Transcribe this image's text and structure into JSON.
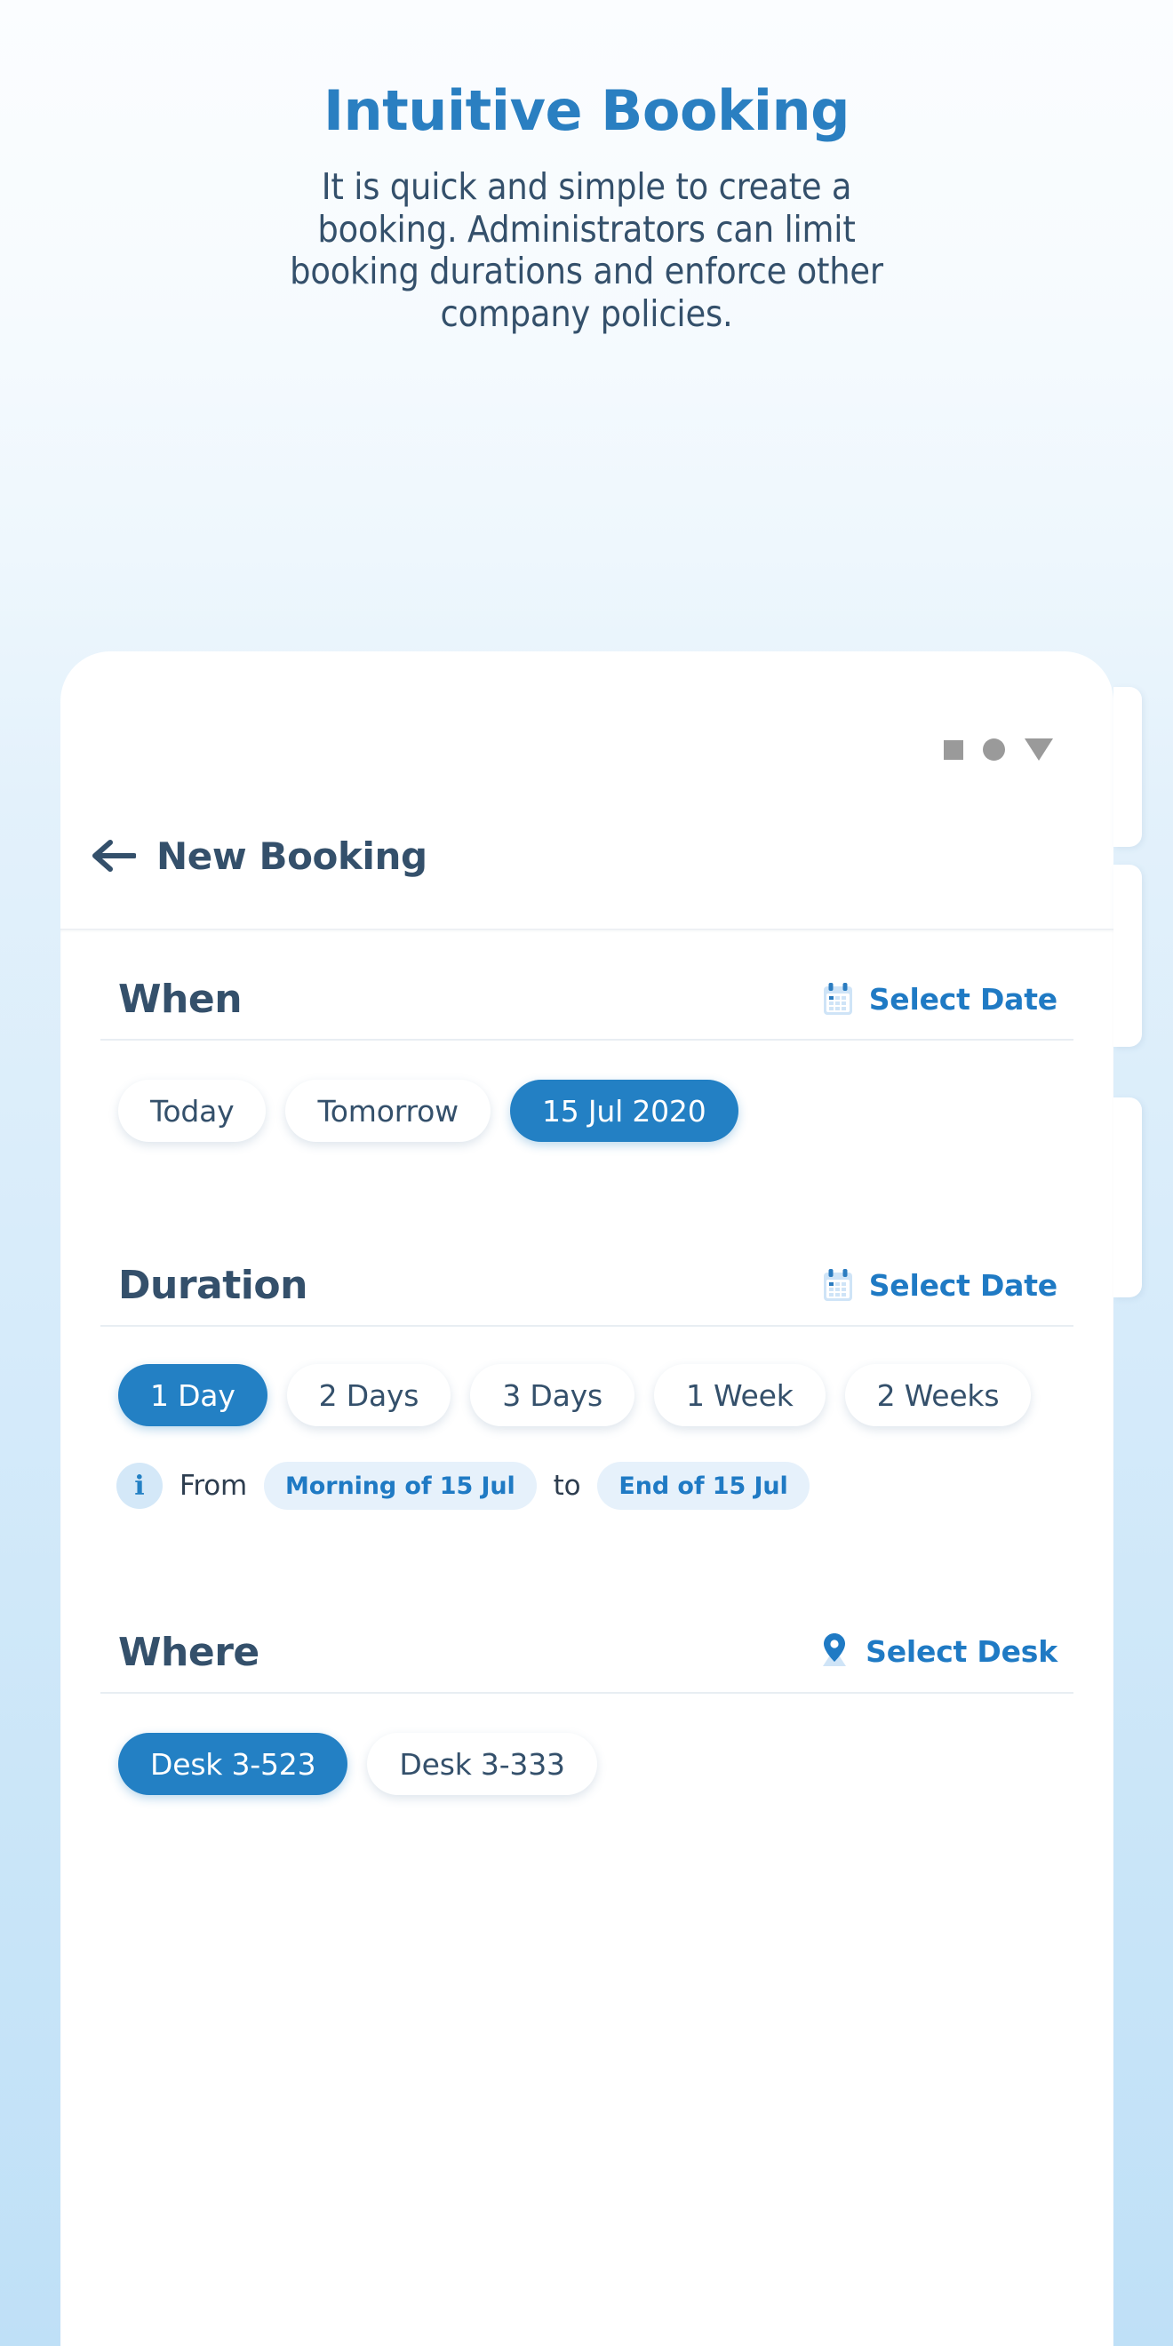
{
  "hero": {
    "title": "Intuitive Booking",
    "subtitle": "It is quick and simple to create a booking. Administrators can limit booking durations and enforce other company policies.",
    "title_color": "#2a7fc1",
    "subtitle_color": "#34506b"
  },
  "statusbar": {
    "icons": [
      "square-icon",
      "circle-icon",
      "triangle-down-icon"
    ],
    "color": "#9a9a9a"
  },
  "app": {
    "back_icon": "back-arrow-icon",
    "title": "New Booking",
    "accent_color": "#2380c4",
    "text_color": "#34506b"
  },
  "sections": [
    {
      "id": "when",
      "title": "When",
      "action": {
        "icon": "calendar-icon",
        "label": "Select Date"
      },
      "chips": [
        {
          "label": "Today",
          "selected": false
        },
        {
          "label": "Tomorrow",
          "selected": false
        },
        {
          "label": "15 Jul 2020",
          "selected": true
        }
      ]
    },
    {
      "id": "duration",
      "title": "Duration",
      "action": {
        "icon": "calendar-icon",
        "label": "Select Date"
      },
      "chips": [
        {
          "label": "1 Day",
          "selected": true
        },
        {
          "label": "2 Days",
          "selected": false
        },
        {
          "label": "3 Days",
          "selected": false
        },
        {
          "label": "1 Week",
          "selected": false
        },
        {
          "label": "2 Weeks",
          "selected": false
        }
      ],
      "info": {
        "badge": "i",
        "prefix": "From",
        "start": "Morning of 15 Jul",
        "separator": "to",
        "end": "End of 15 Jul"
      }
    },
    {
      "id": "where",
      "title": "Where",
      "action": {
        "icon": "location-pin-icon",
        "label": "Select Desk"
      },
      "chips": [
        {
          "label": "Desk 3-523",
          "selected": true
        },
        {
          "label": "Desk 3-333",
          "selected": false
        }
      ]
    }
  ]
}
